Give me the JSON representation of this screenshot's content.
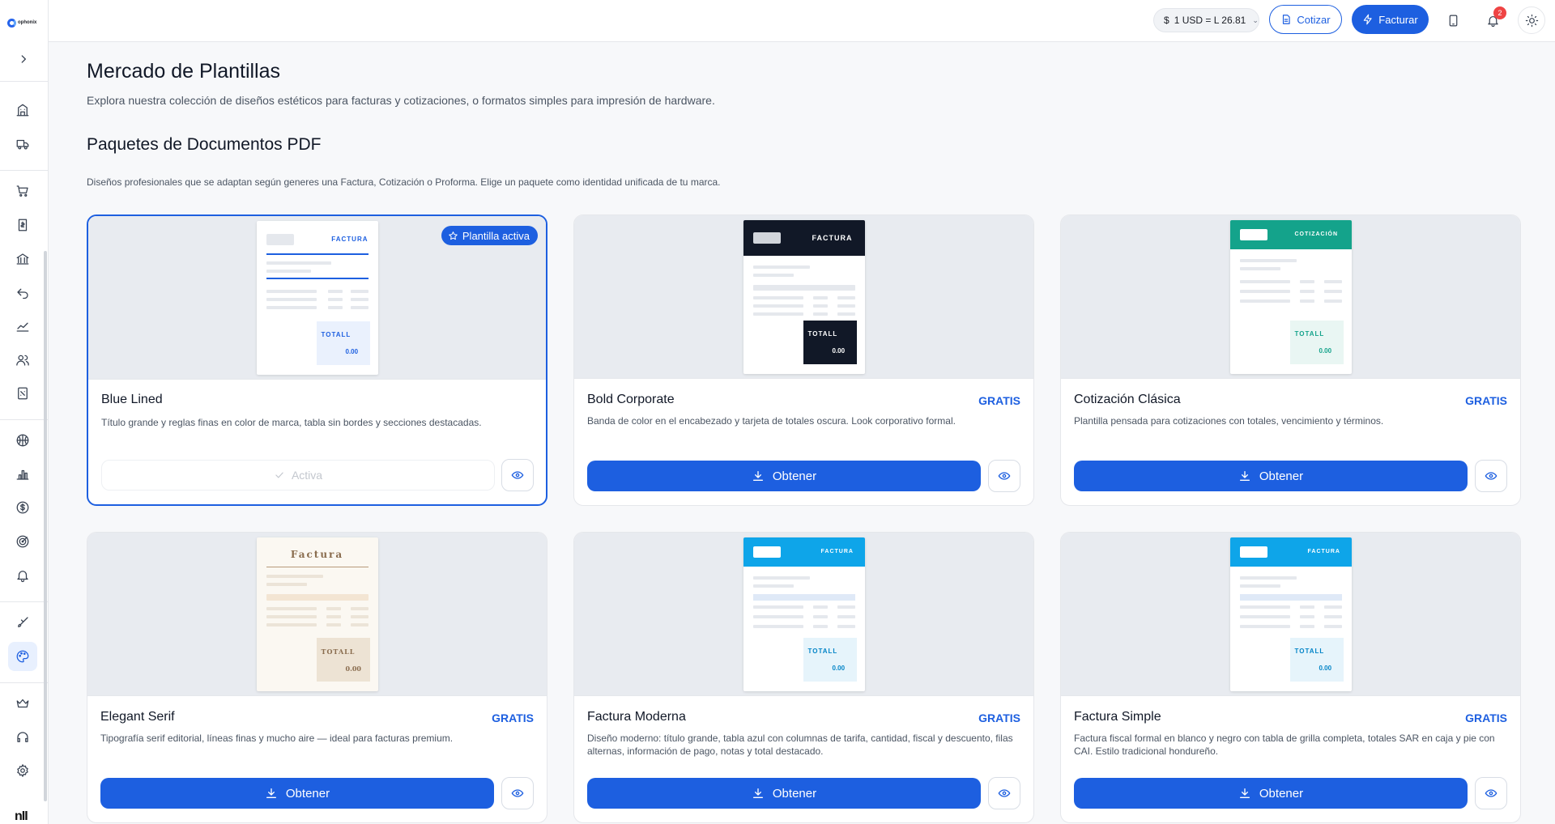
{
  "sidebar": {
    "logo_text": "ophonix",
    "bottom_brand": "nII"
  },
  "header": {
    "rate_label": "1 USD = L 26.81",
    "rate_symbol": "$",
    "quote_label": "Cotizar",
    "invoice_label": "Facturar",
    "notifications_count": "2"
  },
  "page": {
    "title": "Mercado de Plantillas",
    "subtitle": "Explora nuestra colección de diseños estéticos para facturas y cotizaciones, o formatos simples para impresión de hardware.",
    "section_title": "Paquetes de Documentos PDF",
    "section_subtitle": "Diseños profesionales que se adaptan según generes una Factura, Cotización o Proforma. Elige un paquete como identidad unificada de tu marca."
  },
  "cards": [
    {
      "name": "Blue Lined",
      "tag": "",
      "description": "Título grande y reglas finas en color de marca, tabla sin bordes y secciones destacadas.",
      "active": true,
      "active_pill": "Plantilla activa",
      "button_label": "Activa",
      "doc_title": "FACTURA",
      "total_label": "TOTALL",
      "total_value": "0.00"
    },
    {
      "name": "Bold Corporate",
      "tag": "GRATIS",
      "description": "Banda de color en el encabezado y tarjeta de totales oscura. Look corporativo formal.",
      "active": false,
      "button_label": "Obtener",
      "doc_title": "FACTURA",
      "total_label": "TOTALL",
      "total_value": "0.00"
    },
    {
      "name": "Cotización Clásica",
      "tag": "GRATIS",
      "description": "Plantilla pensada para cotizaciones con totales, vencimiento y términos.",
      "active": false,
      "button_label": "Obtener",
      "doc_title": "COTIZACIÓN",
      "total_label": "TOTALL",
      "total_value": "0.00"
    },
    {
      "name": "Elegant Serif",
      "tag": "GRATIS",
      "description": "Tipografía serif editorial, líneas finas y mucho aire — ideal para facturas premium.",
      "active": false,
      "button_label": "Obtener",
      "doc_title": "Factura",
      "total_label": "TOTALL",
      "total_value": "0.00"
    },
    {
      "name": "Factura Moderna",
      "tag": "GRATIS",
      "description": "Diseño moderno: título grande, tabla azul con columnas de tarifa, cantidad, fiscal y descuento, filas alternas, información de pago, notas y total destacado.",
      "active": false,
      "button_label": "Obtener",
      "doc_title": "FACTURA",
      "total_label": "TOTALL",
      "total_value": "0.00"
    },
    {
      "name": "Factura Simple",
      "tag": "GRATIS",
      "description": "Factura fiscal formal en blanco y negro con tabla de grilla completa, totales SAR en caja y pie con CAI. Estilo tradicional hondureño.",
      "active": false,
      "button_label": "Obtener",
      "doc_title": "FACTURA",
      "total_label": "TOTALL",
      "total_value": "0.00"
    }
  ],
  "colors": {
    "primary": "#1d5fe0",
    "dark": "#0f172a",
    "teal": "#14a38b",
    "sky": "#0ea5e9",
    "serif_brown": "#8a6d4f"
  }
}
